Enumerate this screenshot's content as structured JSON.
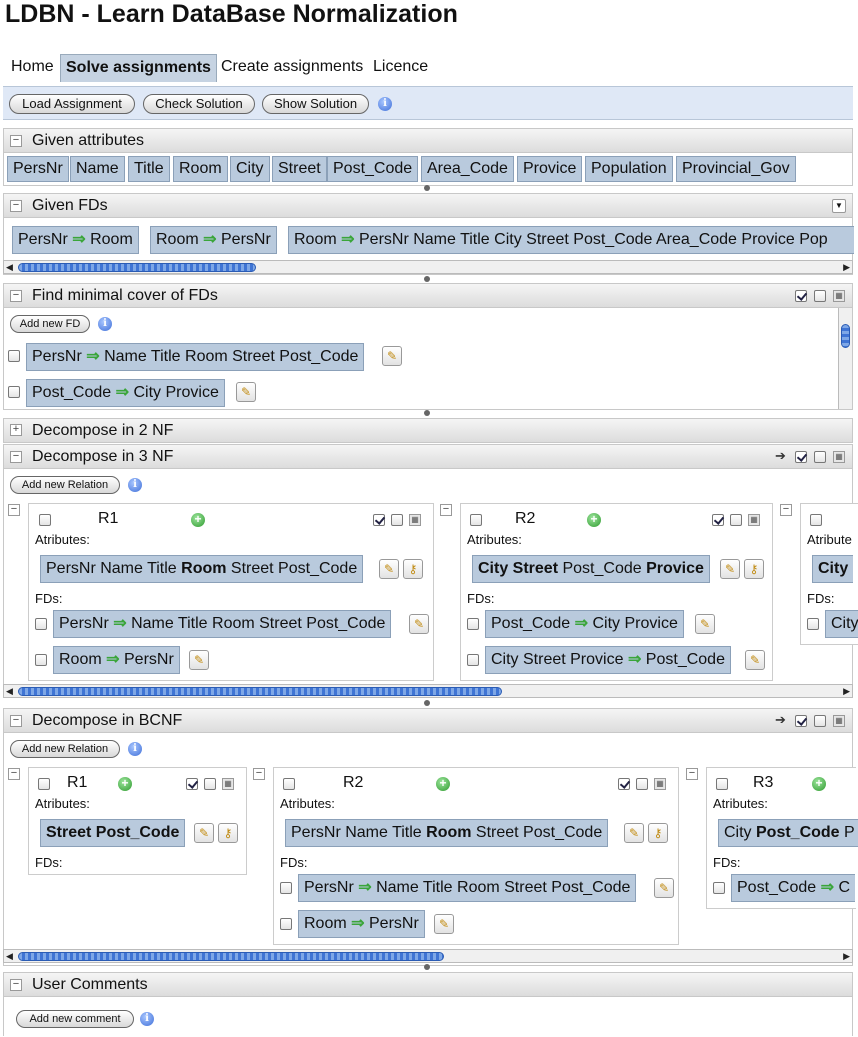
{
  "app": {
    "title": "LDBN - Learn DataBase Normalization"
  },
  "nav": {
    "tabs": [
      {
        "label": "Home"
      },
      {
        "label": "Solve assignments"
      },
      {
        "label": "Create assignments"
      },
      {
        "label": "Licence"
      }
    ],
    "active_tab": "Solve assignments"
  },
  "toolbar": {
    "load": "Load Assignment",
    "check": "Check Solution",
    "show": "Show Solution"
  },
  "given_attributes": {
    "title": "Given attributes",
    "items": [
      "PersNr",
      "Name",
      "Title",
      "Room",
      "City",
      "Street",
      "Post_Code",
      "Area_Code",
      "Provice",
      "Population",
      "Provincial_Gov"
    ]
  },
  "given_fds": {
    "title": "Given FDs",
    "items": [
      {
        "lhs": "PersNr",
        "rhs": "Room"
      },
      {
        "lhs": "Room",
        "rhs": "PersNr"
      },
      {
        "lhs": "Room",
        "rhs": "PersNr Name Title City Street Post_Code Area_Code Provice Pop"
      }
    ]
  },
  "minimal_cover": {
    "title": "Find minimal cover of FDs",
    "add_label": "Add new FD",
    "items": [
      {
        "lhs": "PersNr",
        "rhs": "Name Title Room Street Post_Code"
      },
      {
        "lhs": "Post_Code",
        "rhs": "City Provice"
      }
    ]
  },
  "nf2": {
    "title": "Decompose in 2 NF"
  },
  "nf3": {
    "title": "Decompose in 3 NF",
    "add_label": "Add new Relation",
    "relations": [
      {
        "name": "R1",
        "attr_label": "Atributes:",
        "attrs": {
          "p1": "PersNr Name Title ",
          "bold": "Room",
          "p2": " Street Post_Code"
        },
        "fd_label": "FDs:",
        "fds": [
          {
            "lhs": "PersNr",
            "rhs": "Name Title Room Street Post_Code"
          },
          {
            "lhs": "Room",
            "rhs": "PersNr"
          }
        ]
      },
      {
        "name": "R2",
        "attr_label": "Atributes:",
        "attrs": {
          "b1": "City Street",
          "p1": " Post_Code ",
          "b2": "Provice"
        },
        "fd_label": "FDs:",
        "fds": [
          {
            "lhs": "Post_Code",
            "rhs": "City Provice"
          },
          {
            "lhs": "City Street Provice",
            "rhs": "Post_Code"
          }
        ]
      },
      {
        "name": "",
        "attr_label": "Atribute",
        "attrs": {
          "b1": "City"
        },
        "fd_label": "FDs:",
        "fds": [
          {
            "lhs": "City",
            "rhs": ""
          }
        ]
      }
    ]
  },
  "bcnf": {
    "title": "Decompose in BCNF",
    "add_label": "Add new Relation",
    "relations": [
      {
        "name": "R1",
        "attr_label": "Atributes:",
        "attrs": {
          "b1": "Street Post_Code"
        },
        "fd_label": "FDs:"
      },
      {
        "name": "R2",
        "attr_label": "Atributes:",
        "attrs": {
          "p1": "PersNr Name Title ",
          "bold": "Room",
          "p2": " Street Post_Code"
        },
        "fd_label": "FDs:",
        "fds": [
          {
            "lhs": "PersNr",
            "rhs": "Name Title Room Street Post_Code"
          },
          {
            "lhs": "Room",
            "rhs": "PersNr"
          }
        ]
      },
      {
        "name": "R3",
        "attr_label": "Atributes:",
        "attrs": {
          "p1": "City ",
          "b1": "Post_Code",
          "p2": " P"
        },
        "fd_label": "FDs:",
        "fds": [
          {
            "lhs": "Post_Code",
            "rhs": "C"
          }
        ]
      }
    ]
  },
  "comments": {
    "title": "User Comments",
    "add_label": "Add new comment"
  },
  "icons": {
    "info": "info-icon",
    "edit": "pencil-icon",
    "key": "key-icon",
    "add": "plus-icon",
    "collapse": "minus-icon",
    "expand": "plus-box-icon",
    "arrow": "right-arrow-icon",
    "fd_arrow": "⇒",
    "fd_arrow_color": "#3aa53a",
    "chip_color": "#b9cadd",
    "toolbar_color": "#dfe8f6"
  }
}
